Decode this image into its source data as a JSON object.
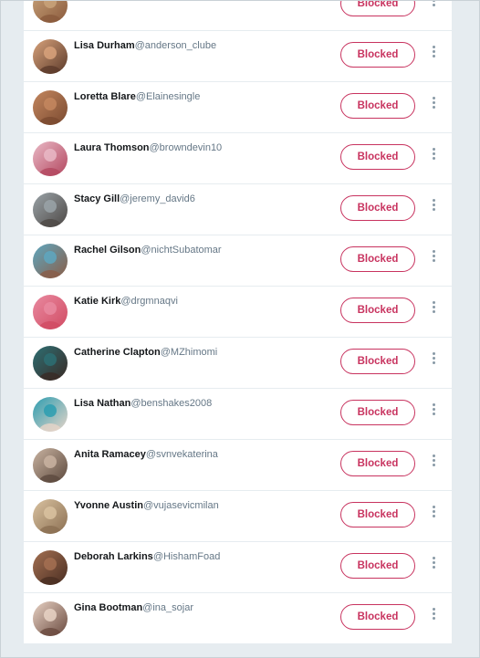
{
  "blocked_label": "Blocked",
  "accent_color": "#c8335f",
  "accounts": [
    {
      "name": "",
      "handle": "",
      "avatar": [
        "#c9a37a",
        "#8a5a3c"
      ]
    },
    {
      "name": "Lisa Durham",
      "handle": "@anderson_clube",
      "avatar": [
        "#d8a27b",
        "#5b3a2a"
      ]
    },
    {
      "name": "Loretta Blare",
      "handle": "@Elainesingle",
      "avatar": [
        "#c4875f",
        "#7a4a30"
      ]
    },
    {
      "name": "Laura Thomson",
      "handle": "@browndevin10",
      "avatar": [
        "#e9b9c6",
        "#b3475f"
      ]
    },
    {
      "name": "Stacy Gill",
      "handle": "@jeremy_david6",
      "avatar": [
        "#9aa3a8",
        "#4d4845"
      ]
    },
    {
      "name": "Rachel Gilson",
      "handle": "@nichtSubatomar",
      "avatar": [
        "#5ea7c0",
        "#8a5d47"
      ]
    },
    {
      "name": "Katie Kirk",
      "handle": "@drgmnaqvi",
      "avatar": [
        "#e98aa0",
        "#d14b63"
      ]
    },
    {
      "name": "Catherine Clapton",
      "handle": "@MZhimomi",
      "avatar": [
        "#2d6f73",
        "#3a2a26"
      ]
    },
    {
      "name": "Lisa Nathan",
      "handle": "@benshakes2008",
      "avatar": [
        "#2c9db0",
        "#e7d4c8"
      ]
    },
    {
      "name": "Anita Ramacey",
      "handle": "@svnvekaterina",
      "avatar": [
        "#c9b3a1",
        "#5d4a3e"
      ]
    },
    {
      "name": "Yvonne Austin",
      "handle": "@vujasevicmilan",
      "avatar": [
        "#d9c2a0",
        "#8b6f52"
      ]
    },
    {
      "name": "Deborah Larkins",
      "handle": "@HishamFoad",
      "avatar": [
        "#a47052",
        "#4a2e22"
      ]
    },
    {
      "name": "Gina Bootman",
      "handle": "@ina_sojar",
      "avatar": [
        "#e8d2c4",
        "#6a4a3f"
      ]
    }
  ]
}
